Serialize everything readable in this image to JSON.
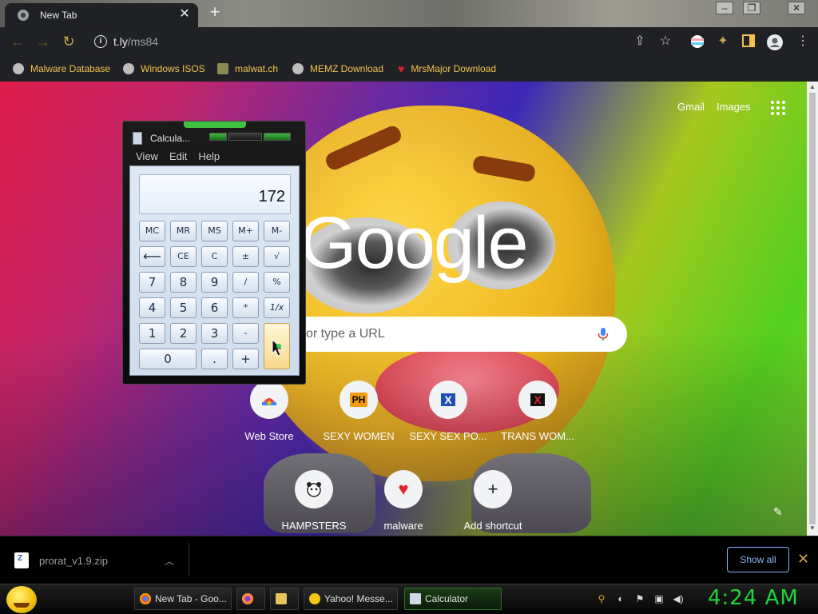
{
  "browser": {
    "tab_title": "New Tab",
    "tab_close": "✕",
    "new_tab": "+",
    "window_controls": [
      "–",
      "❐",
      "✕"
    ],
    "url_host": "t.ly",
    "url_path": "/ms84",
    "bookmarks": [
      {
        "label": "Malware Database",
        "icon": "globe-icon"
      },
      {
        "label": "Windows ISOS",
        "icon": "globe-icon"
      },
      {
        "label": "malwat.ch",
        "icon": "person-icon"
      },
      {
        "label": "MEMZ Download",
        "icon": "globe-icon"
      },
      {
        "label": "MrsMajor Download",
        "icon": "heart-icon"
      }
    ],
    "accent": "#f2c14e"
  },
  "ntp": {
    "links": [
      "Gmail",
      "Images"
    ],
    "logo": "Google",
    "search_placeholder": "or type a URL",
    "shortcuts_row1": [
      "Web Store",
      "SEXY WOMEN",
      "SEXY SEX PO...",
      "TRANS WOM..."
    ],
    "shortcuts_row2": [
      "HAMPSTERS",
      "malware",
      "Add shortcut"
    ],
    "shortcut_badges": {
      "ph": "PH",
      "x": "X",
      "add": "+"
    }
  },
  "downloads": {
    "file": "prorat_v1.9.zip",
    "show_all": "Show all"
  },
  "taskbar": {
    "tasks": [
      "New Tab - Goo...",
      "",
      "",
      "Yahoo! Messe...",
      "Calculator"
    ],
    "clock": "4:24 AM",
    "clock_color": "#22d33c"
  },
  "calculator": {
    "title": "Calcula...",
    "menu": [
      "View",
      "Edit",
      "Help"
    ],
    "display": "172",
    "rows": [
      [
        "MC",
        "MR",
        "MS",
        "M+",
        "M-"
      ],
      [
        "⟵",
        "CE",
        "C",
        "±",
        "√"
      ],
      [
        "7",
        "8",
        "9",
        "/",
        "%"
      ],
      [
        "4",
        "5",
        "6",
        "*",
        "1/x"
      ],
      [
        "1",
        "2",
        "3",
        "-",
        ""
      ],
      [
        "0",
        ".",
        "+"
      ]
    ]
  }
}
